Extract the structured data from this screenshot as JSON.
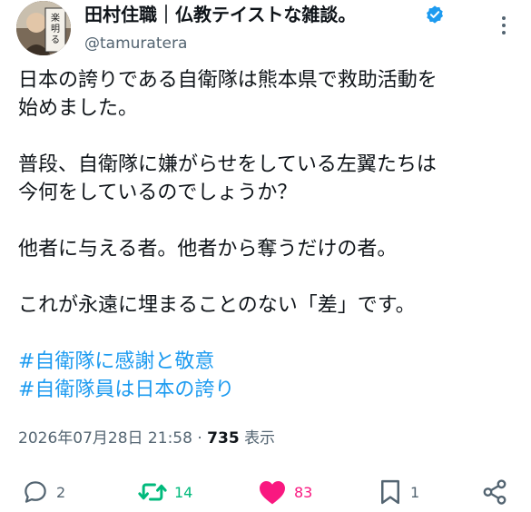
{
  "author": {
    "display_name": "田村住職｜仏教テイストな雑談。",
    "handle": "@tamuratera",
    "verified": true,
    "avatar_sign_text": "楽しく明るく"
  },
  "tweet": {
    "lines": [
      "日本の誇りである自衛隊は熊本県で救助活動を",
      "始めました。",
      "",
      "普段、自衛隊に嫌がらせをしている左翼たちは",
      "今何をしているのでしょうか？",
      "",
      "他者に与える者。他者から奪うだけの者。",
      "",
      "これが永遠に埋まることのない「差」です。",
      ""
    ],
    "hashtags": [
      "#自衛隊に感謝と敬意",
      "#自衛隊員は日本の誇り"
    ]
  },
  "meta": {
    "timestamp": "2026年07月28日 21:58",
    "separator": "·",
    "views_count": "735",
    "views_label": "表示"
  },
  "actions": {
    "reply_count": "2",
    "retweet_count": "14",
    "like_count": "83",
    "bookmark_count": "1"
  },
  "colors": {
    "link": "#1d9bf0",
    "retweet": "#00ba7c",
    "like": "#f91880",
    "muted": "#536471",
    "verified": "#1d9bf0"
  }
}
